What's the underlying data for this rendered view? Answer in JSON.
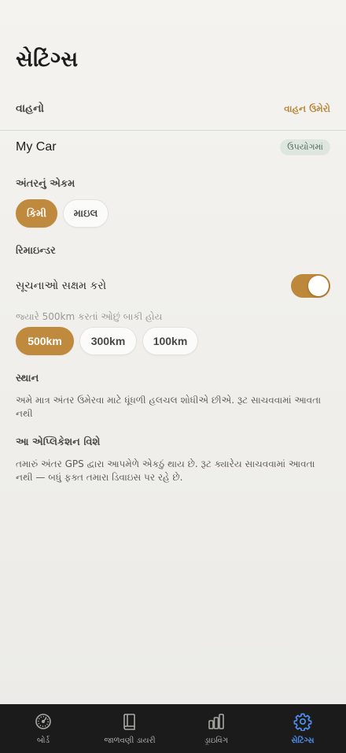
{
  "header": {
    "title": "સેટિંગ્સ"
  },
  "vehicles": {
    "section_label": "વાહનો",
    "add_link": "વાહન ઉમેરો",
    "car_name": "My Car",
    "car_badge": "ઉપયોગમાં"
  },
  "units": {
    "label": "અંતરનું એકમ",
    "options": [
      "કિમી",
      "માઇલ"
    ],
    "selected": "કિમી"
  },
  "reminders": {
    "label": "રિમાઇન્ડર",
    "enable_label": "સૂચનાઓ સક્ષમ કરો",
    "enabled": true,
    "threshold_hint": "જ્યારે 500km કરતાં ઓછું બાકી હોય",
    "thresholds": [
      "500km",
      "300km",
      "100km"
    ],
    "selected_threshold": "500km"
  },
  "location": {
    "label": "સ્થાન",
    "text": "અમે માત્ર અંતર ઉમેરવા માટે ધૂંધળી હલચલ શોધીએ છીએ. રૂટ સાચવવામાં આવતા નથી"
  },
  "about": {
    "label": "આ એપ્લિકેશન વિશે",
    "text": "તમારું અંતર GPS દ્વારા આપમેળે એકઠું થાય છે. રૂટ ક્યારેય સાચવવામાં આવતા નથી — બધું ફક્ત તમારા ડિવાઇસ પર રહે છે."
  },
  "tabbar": {
    "items": [
      {
        "label": "બોર્ડ",
        "icon": "gauge-icon"
      },
      {
        "label": "જાળવણી ડાયરી",
        "icon": "book-icon"
      },
      {
        "label": "ડ્રાઇવિંગ",
        "icon": "bars-icon"
      },
      {
        "label": "સેટિંગ્સ",
        "icon": "gear-icon"
      }
    ],
    "active": "સેટિંગ્સ"
  },
  "colors": {
    "accent": "#c08a3e",
    "active_tab": "#4f8ff0",
    "tabbar_bg": "#1b1b1b"
  }
}
